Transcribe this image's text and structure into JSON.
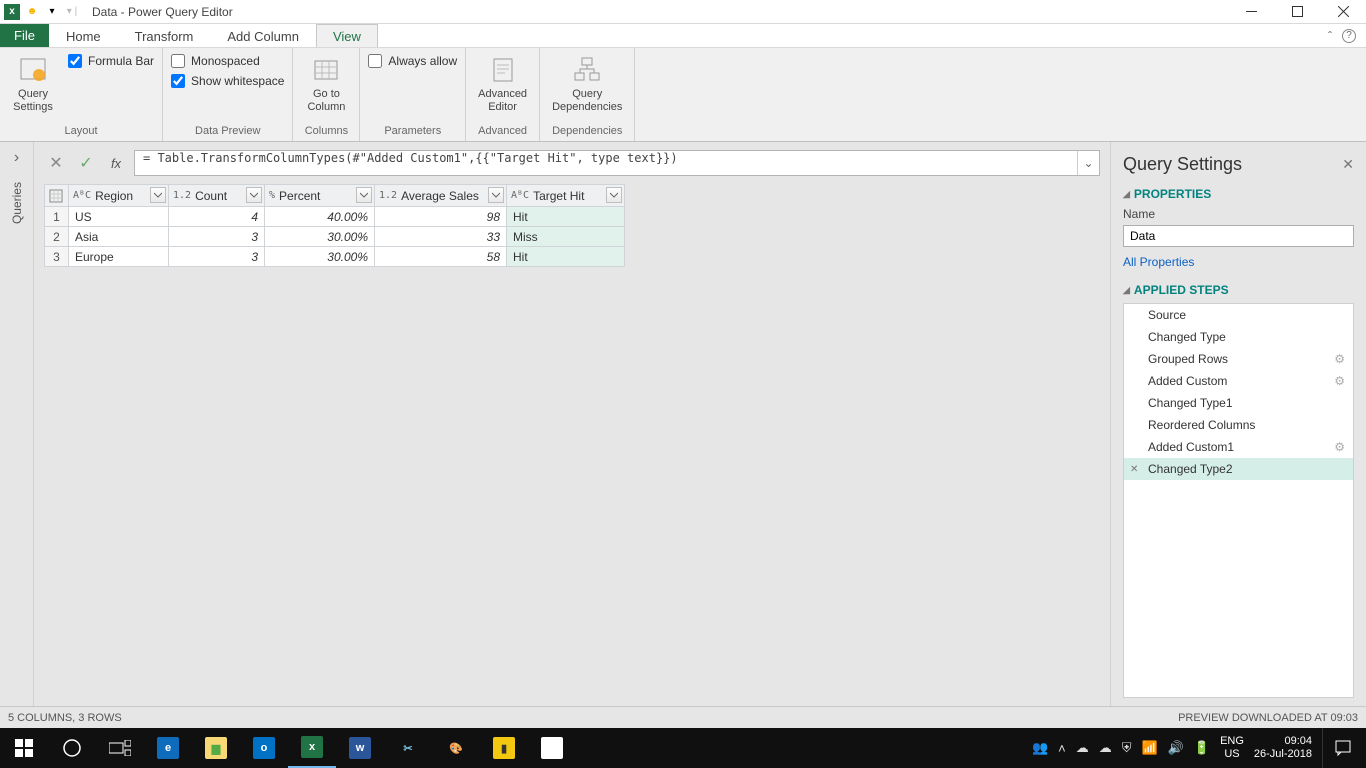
{
  "window": {
    "title": "Data - Power Query Editor"
  },
  "menu": {
    "file": "File",
    "tabs": [
      "Home",
      "Transform",
      "Add Column",
      "View"
    ],
    "active": 3
  },
  "ribbon": {
    "layout": {
      "label": "Layout",
      "btn": "Query\nSettings",
      "chk_formula": "Formula Bar"
    },
    "preview": {
      "label": "Data Preview",
      "chk_mono": "Monospaced",
      "chk_ws": "Show whitespace"
    },
    "columns": {
      "label": "Columns",
      "btn": "Go to\nColumn"
    },
    "parameters": {
      "label": "Parameters",
      "chk_allow": "Always allow"
    },
    "advanced": {
      "label": "Advanced",
      "btn": "Advanced\nEditor"
    },
    "dependencies": {
      "label": "Dependencies",
      "btn": "Query\nDependencies"
    }
  },
  "leftrail": {
    "label": "Queries"
  },
  "formula": "= Table.TransformColumnTypes(#\"Added Custom1\",{{\"Target Hit\", type text}})",
  "columns": [
    {
      "name": "Region",
      "type": "AᴮC",
      "w": 100
    },
    {
      "name": "Count",
      "type": "1.2",
      "w": 96
    },
    {
      "name": "Percent",
      "type": "%",
      "w": 110
    },
    {
      "name": "Average Sales",
      "type": "1.2",
      "w": 132
    },
    {
      "name": "Target Hit",
      "type": "AᴮC",
      "w": 118,
      "sel": true
    }
  ],
  "rows": [
    {
      "n": 1,
      "cells": [
        "US",
        "4",
        "40.00%",
        "98",
        "Hit"
      ]
    },
    {
      "n": 2,
      "cells": [
        "Asia",
        "3",
        "30.00%",
        "33",
        "Miss"
      ]
    },
    {
      "n": 3,
      "cells": [
        "Europe",
        "3",
        "30.00%",
        "58",
        "Hit"
      ]
    }
  ],
  "panel": {
    "title": "Query Settings",
    "properties": "PROPERTIES",
    "name_label": "Name",
    "name_value": "Data",
    "all_props": "All Properties",
    "applied": "APPLIED STEPS",
    "steps": [
      {
        "t": "Source"
      },
      {
        "t": "Changed Type"
      },
      {
        "t": "Grouped Rows",
        "gear": true
      },
      {
        "t": "Added Custom",
        "gear": true
      },
      {
        "t": "Changed Type1"
      },
      {
        "t": "Reordered Columns"
      },
      {
        "t": "Added Custom1",
        "gear": true
      },
      {
        "t": "Changed Type2",
        "sel": true
      }
    ]
  },
  "status": {
    "left": "5 COLUMNS, 3 ROWS",
    "right": "PREVIEW DOWNLOADED AT 09:03"
  },
  "taskbar": {
    "lang1": "ENG",
    "lang2": "US",
    "time": "09:04",
    "date": "26-Jul-2018"
  }
}
